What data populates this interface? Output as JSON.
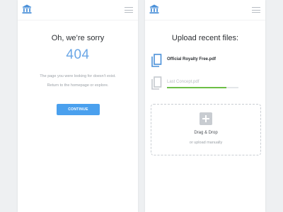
{
  "colors": {
    "accent": "#4aa0ee",
    "logo": "#4a90d9",
    "error_code": "#6aa6e6",
    "progress": "#6cbe45",
    "page_background": "#eef0f2"
  },
  "icons": {
    "logo": "bank-building-icon",
    "menu": "hamburger-menu-icon",
    "file": "copy-file-icon",
    "add": "plus-icon"
  },
  "error_screen": {
    "title": "Oh, we’re sorry",
    "code": "404",
    "message_line1": "The page you were looking for doesn’t exist.",
    "message_line2": "Return to the homepage or explore.",
    "continue_label": "CONTINUE"
  },
  "upload_screen": {
    "title": "Upload recent files:",
    "files": [
      {
        "name": "Official Royalty Free.pdf",
        "status": "uploaded"
      },
      {
        "name": "Last Concept.pdf",
        "status": "uploading",
        "progress": 0.83
      }
    ],
    "drop_title": "Drag & Drop",
    "drop_subtitle": "or upload manually"
  }
}
